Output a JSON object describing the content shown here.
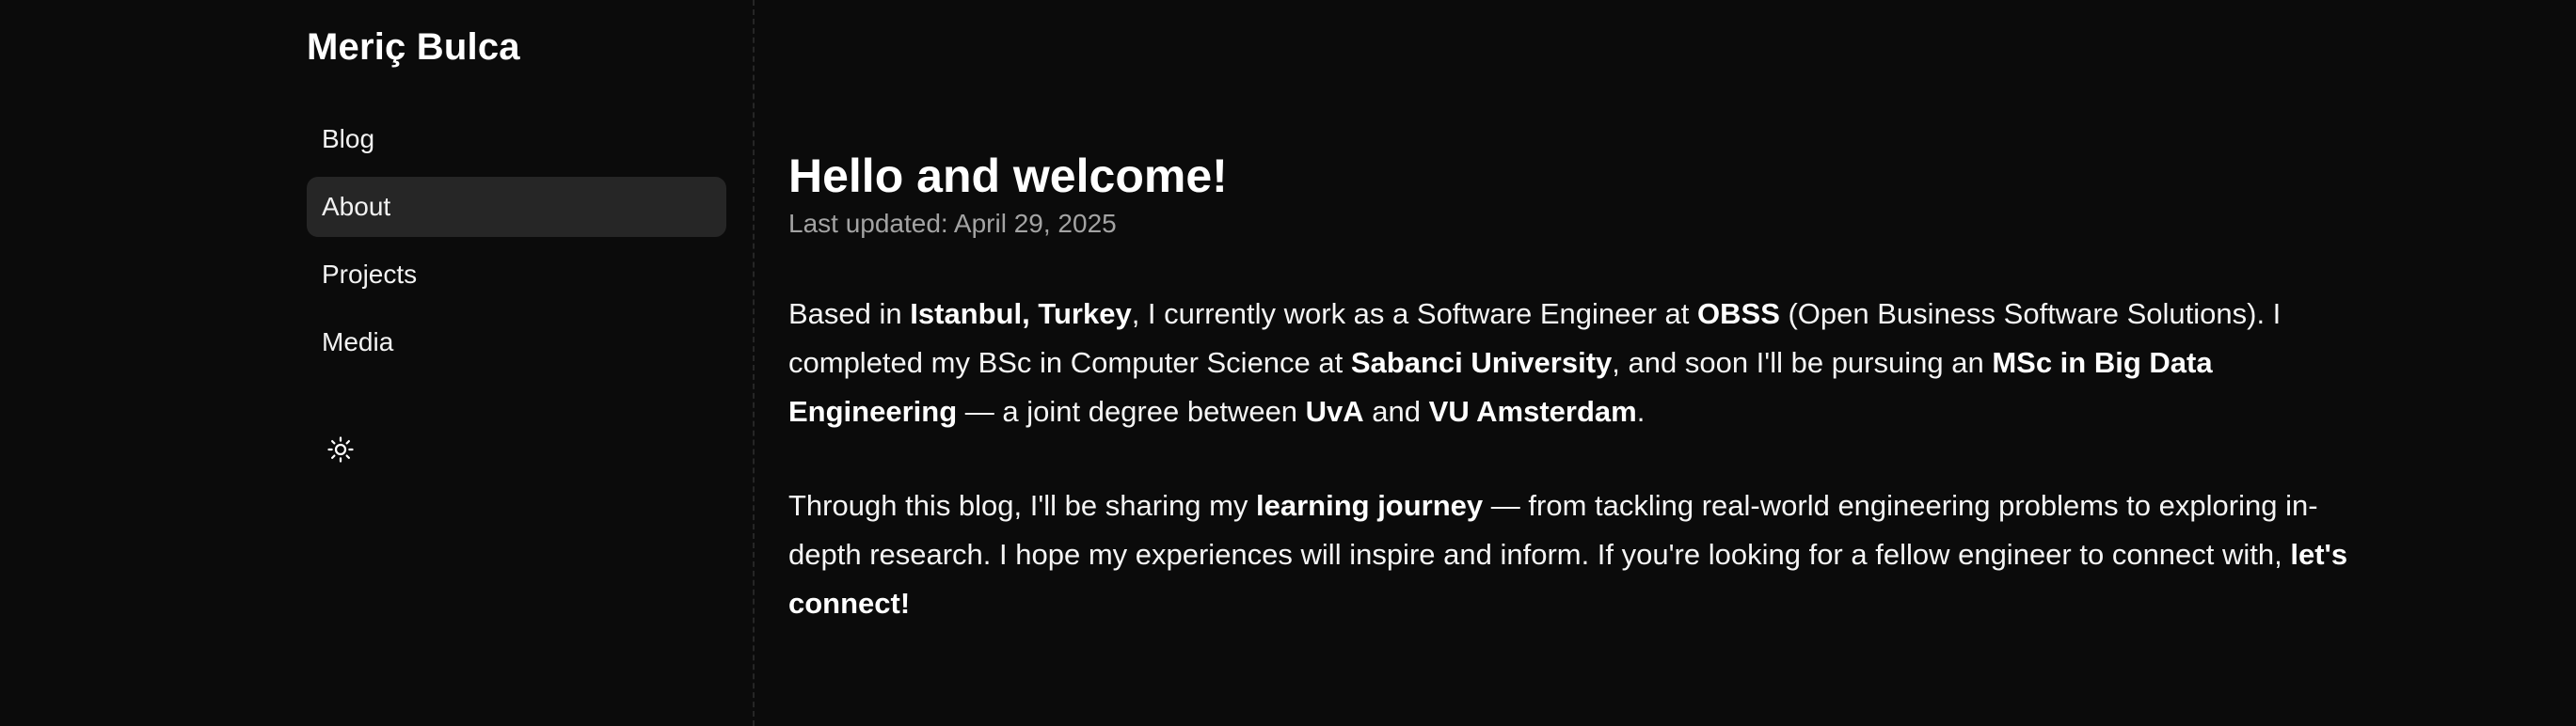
{
  "site": {
    "title": "Meriç Bulca"
  },
  "nav": {
    "items": [
      {
        "label": "Blog",
        "active": false
      },
      {
        "label": "About",
        "active": true
      },
      {
        "label": "Projects",
        "active": false
      },
      {
        "label": "Media",
        "active": false
      }
    ],
    "theme_toggle_icon": "sun-icon"
  },
  "page": {
    "title": "Hello and welcome!",
    "updated": "Last updated: April 29, 2025",
    "p1": {
      "t1": "Based in ",
      "b1": "Istanbul, Turkey",
      "t2": ", I currently work as a Software Engineer at ",
      "b2": "OBSS",
      "t3": " (Open Business Software Solutions). I completed my BSc in Computer Science at ",
      "b3": "Sabanci University",
      "t4": ", and soon I'll be pursuing an ",
      "b4": "MSc in Big Data Engineering",
      "t5": " — a joint degree between ",
      "b5": "UvA",
      "t6": " and ",
      "b6": "VU Amsterdam",
      "t7": "."
    },
    "p2": {
      "t1": "Through this blog, I'll be sharing my ",
      "b1": "learning journey",
      "t2": " — from tackling real-world engineering problems to exploring in-depth research. I hope my experiences will inspire and inform. If you're looking for a fellow engineer to connect with, ",
      "b2": "let's connect!"
    }
  },
  "colors": {
    "background": "#0b0b0b",
    "active_nav_bg": "#262626",
    "muted_text": "#a3a3a3",
    "text": "#ffffff"
  }
}
